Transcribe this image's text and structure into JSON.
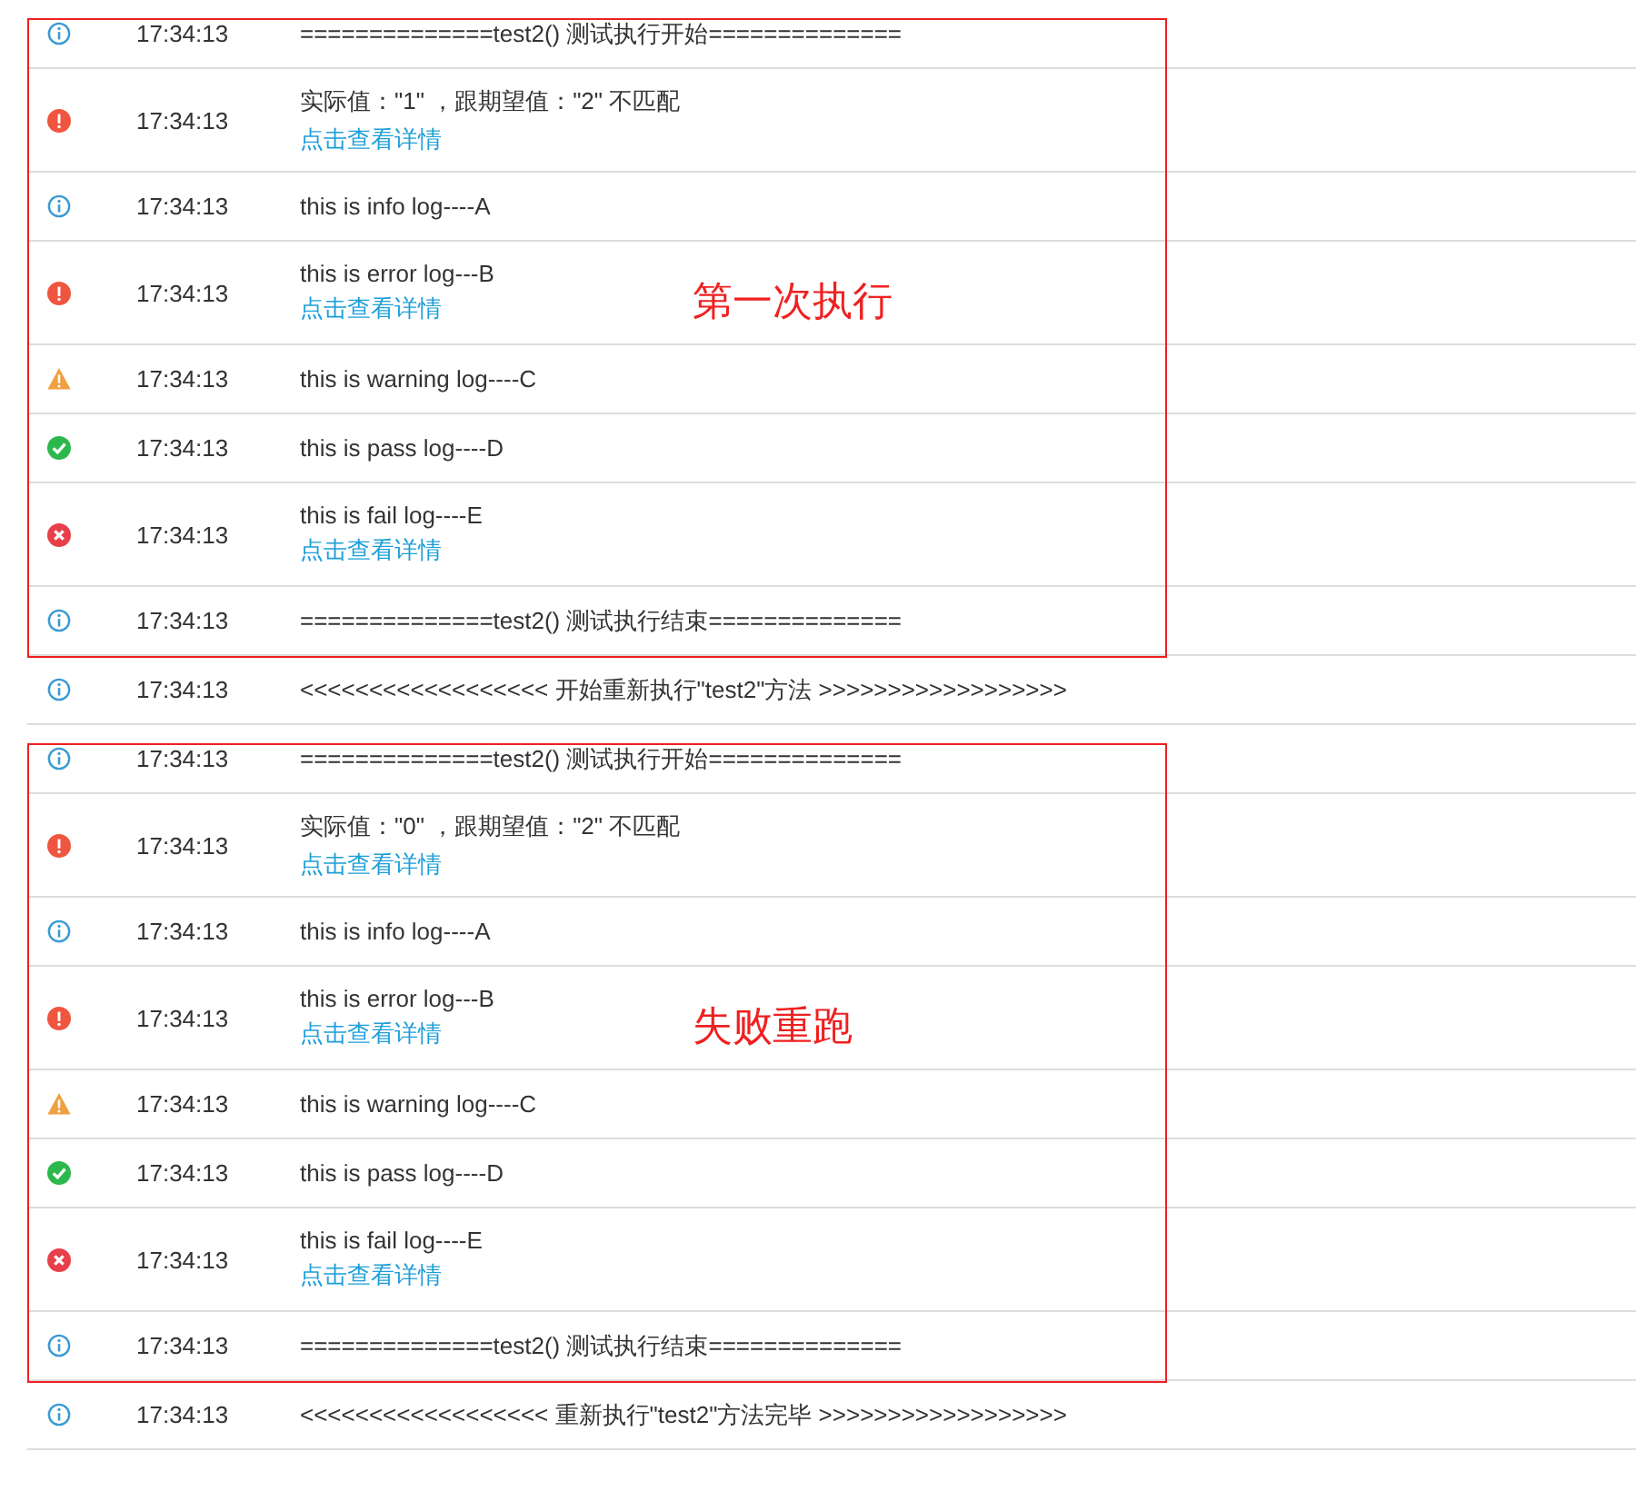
{
  "sections": [
    {
      "annotation": "第一次执行",
      "entries": [
        {
          "kind": "info",
          "time": "17:34:13",
          "message": "==============test2() 测试执行开始=============="
        },
        {
          "kind": "error",
          "time": "17:34:13",
          "message": "实际值：\"1\" ，跟期望值：\"2\" 不匹配",
          "link": "点击查看详情"
        },
        {
          "kind": "info",
          "time": "17:34:13",
          "message": "this is info log----A"
        },
        {
          "kind": "error",
          "time": "17:34:13",
          "message": "this is error log---B",
          "link": "点击查看详情"
        },
        {
          "kind": "warning",
          "time": "17:34:13",
          "message": "this is warning log----C"
        },
        {
          "kind": "pass",
          "time": "17:34:13",
          "message": "this is pass log----D"
        },
        {
          "kind": "fail",
          "time": "17:34:13",
          "message": "this is fail log----E",
          "link": "点击查看详情"
        },
        {
          "kind": "info",
          "time": "17:34:13",
          "message": "==============test2() 测试执行结束=============="
        }
      ]
    },
    {
      "entries": [
        {
          "kind": "info",
          "time": "17:34:13",
          "message": "<<<<<<<<<<<<<<<<<< 开始重新执行\"test2\"方法 >>>>>>>>>>>>>>>>>>"
        }
      ]
    },
    {
      "annotation": "失败重跑",
      "entries": [
        {
          "kind": "info",
          "time": "17:34:13",
          "message": "==============test2() 测试执行开始=============="
        },
        {
          "kind": "error",
          "time": "17:34:13",
          "message": "实际值：\"0\" ，跟期望值：\"2\" 不匹配",
          "link": "点击查看详情"
        },
        {
          "kind": "info",
          "time": "17:34:13",
          "message": "this is info log----A"
        },
        {
          "kind": "error",
          "time": "17:34:13",
          "message": "this is error log---B",
          "link": "点击查看详情"
        },
        {
          "kind": "warning",
          "time": "17:34:13",
          "message": "this is warning log----C"
        },
        {
          "kind": "pass",
          "time": "17:34:13",
          "message": "this is pass log----D"
        },
        {
          "kind": "fail",
          "time": "17:34:13",
          "message": "this is fail log----E",
          "link": "点击查看详情"
        },
        {
          "kind": "info",
          "time": "17:34:13",
          "message": "==============test2() 测试执行结束=============="
        }
      ]
    },
    {
      "entries": [
        {
          "kind": "info",
          "time": "17:34:13",
          "message": "<<<<<<<<<<<<<<<<<< 重新执行\"test2\"方法完毕 >>>>>>>>>>>>>>>>>>"
        }
      ]
    }
  ]
}
